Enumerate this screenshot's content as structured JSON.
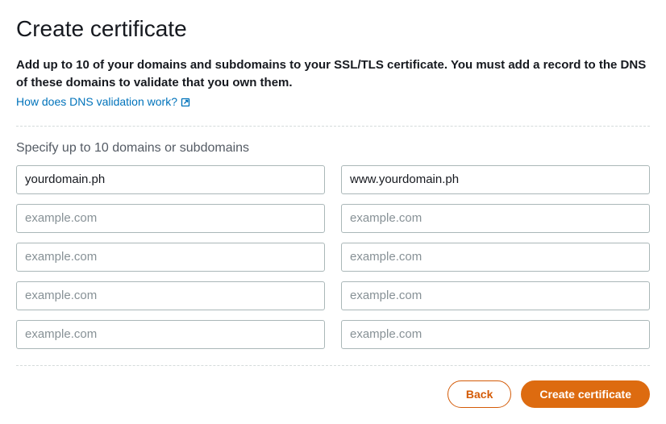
{
  "header": {
    "title": "Create certificate",
    "instruction": "Add up to 10 of your domains and subdomains to your SSL/TLS certificate. You must add a record to the DNS of these domains to validate that you own them.",
    "help_link": "How does DNS validation work?"
  },
  "form": {
    "section_label": "Specify up to 10 domains or subdomains",
    "fields": [
      {
        "value": "yourdomain.ph",
        "placeholder": "example.com"
      },
      {
        "value": "www.yourdomain.ph",
        "placeholder": "example.com"
      },
      {
        "value": "",
        "placeholder": "example.com"
      },
      {
        "value": "",
        "placeholder": "example.com"
      },
      {
        "value": "",
        "placeholder": "example.com"
      },
      {
        "value": "",
        "placeholder": "example.com"
      },
      {
        "value": "",
        "placeholder": "example.com"
      },
      {
        "value": "",
        "placeholder": "example.com"
      },
      {
        "value": "",
        "placeholder": "example.com"
      },
      {
        "value": "",
        "placeholder": "example.com"
      }
    ]
  },
  "buttons": {
    "back": "Back",
    "create": "Create certificate"
  }
}
